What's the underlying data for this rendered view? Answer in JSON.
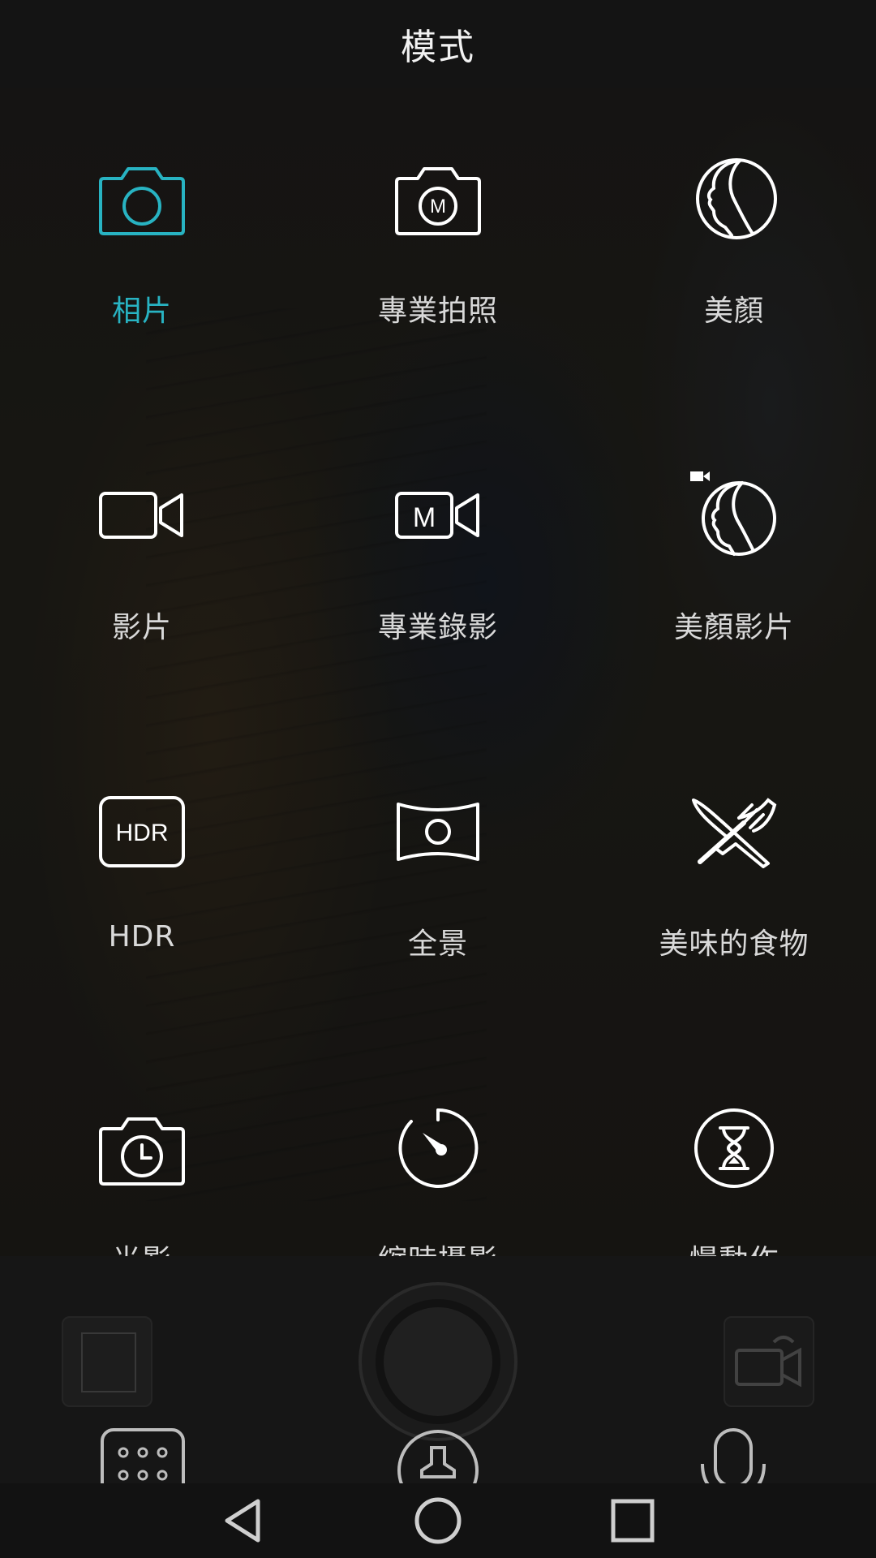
{
  "header": {
    "title": "模式"
  },
  "modes": [
    {
      "label": "相片",
      "icon": "camera-icon",
      "active": true
    },
    {
      "label": "專業拍照",
      "icon": "pro-camera-icon",
      "active": false
    },
    {
      "label": "美顏",
      "icon": "face-icon",
      "active": false
    },
    {
      "label": "影片",
      "icon": "video-camera-icon",
      "active": false
    },
    {
      "label": "專業錄影",
      "icon": "pro-video-icon",
      "active": false
    },
    {
      "label": "美顏影片",
      "icon": "beauty-video-icon",
      "active": false
    },
    {
      "label": "HDR",
      "icon": "hdr-icon",
      "icon_text": "HDR",
      "active": false
    },
    {
      "label": "全景",
      "icon": "panorama-icon",
      "active": false
    },
    {
      "label": "美味的食物",
      "icon": "food-icon",
      "active": false
    },
    {
      "label": "光影",
      "icon": "light-painting-icon",
      "active": false
    },
    {
      "label": "縮時攝影",
      "icon": "time-lapse-icon",
      "active": false
    },
    {
      "label": "慢動作",
      "icon": "slow-motion-icon",
      "active": false
    }
  ],
  "pro_icon_letter": "M",
  "colors": {
    "accent": "#28b3c2",
    "icon": "#ffffff",
    "label": "#d9d9d9"
  },
  "navigation": {
    "back": "back-icon",
    "home": "home-icon",
    "recents": "recents-icon"
  }
}
